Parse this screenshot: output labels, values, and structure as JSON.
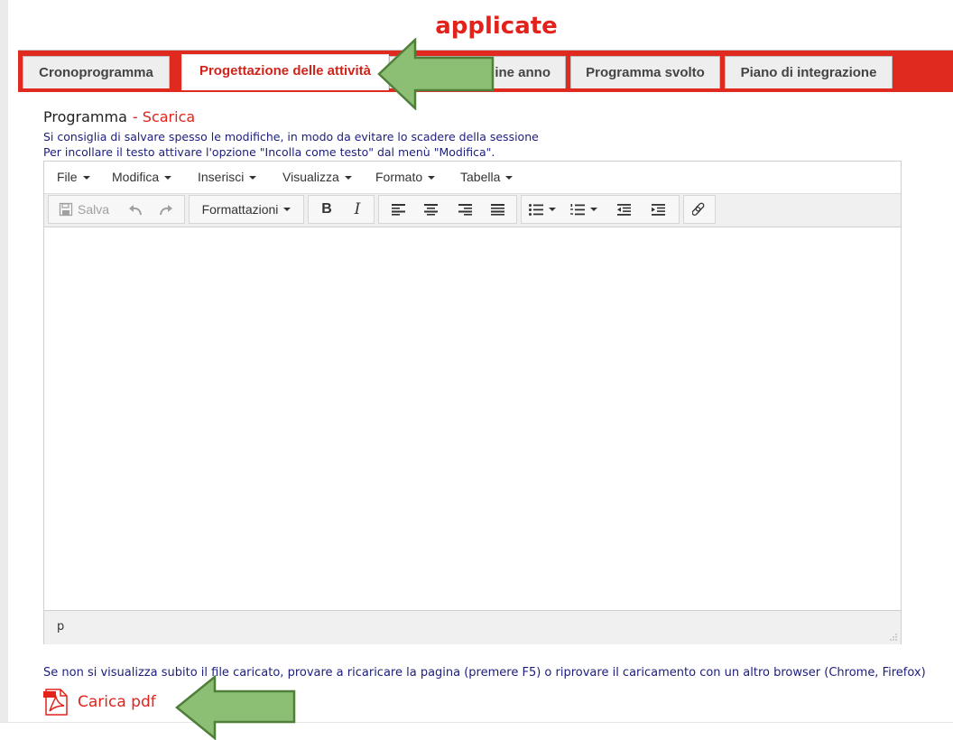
{
  "page_title": "applicate",
  "tabs": [
    {
      "label": "Cronoprogramma",
      "active": false
    },
    {
      "label": "Progettazione delle attività",
      "active": true
    },
    {
      "label": "ine anno",
      "active": false
    },
    {
      "label": "Programma svolto",
      "active": false
    },
    {
      "label": "Piano di integrazione",
      "active": false
    }
  ],
  "section": {
    "label": "Programma",
    "separator": "-",
    "download_link": "Scarica",
    "hint1": "Si consiglia di salvare spesso le modifiche, in modo da evitare lo scadere della sessione",
    "hint2": "Per incollare il testo attivare l'opzione \"Incolla come testo\" dal menù \"Modifica\"."
  },
  "editor": {
    "menus": [
      "File",
      "Modifica",
      "Inserisci",
      "Visualizza",
      "Formato",
      "Tabella"
    ],
    "toolbar": {
      "save_label": "Salva",
      "formats_label": "Formattazioni",
      "bold_label": "B",
      "italic_label": "I"
    },
    "status_path": "p"
  },
  "footer": {
    "reload_note": "Se non si visualizza subito il file caricato, provare a ricaricare la pagina (premere F5) o riprovare il caricamento con un altro browser (Chrome, Firefox)",
    "upload_label": "Carica pdf"
  },
  "icons": {
    "save": "save-icon",
    "undo": "undo-icon",
    "redo": "redo-icon",
    "align_left": "align-left-icon",
    "align_center": "align-center-icon",
    "align_right": "align-right-icon",
    "align_justify": "align-justify-icon",
    "bullet_list": "bullet-list-icon",
    "numbered_list": "numbered-list-icon",
    "outdent": "outdent-icon",
    "indent": "indent-icon",
    "link": "link-icon",
    "pdf": "pdf-icon"
  },
  "colors": {
    "accent_red": "#e3231b",
    "tab_band": "#e02a1f",
    "hint_text": "#1c1d7c",
    "annotation_arrow_fill": "#8cbf73",
    "annotation_arrow_stroke": "#4f7f3a"
  }
}
